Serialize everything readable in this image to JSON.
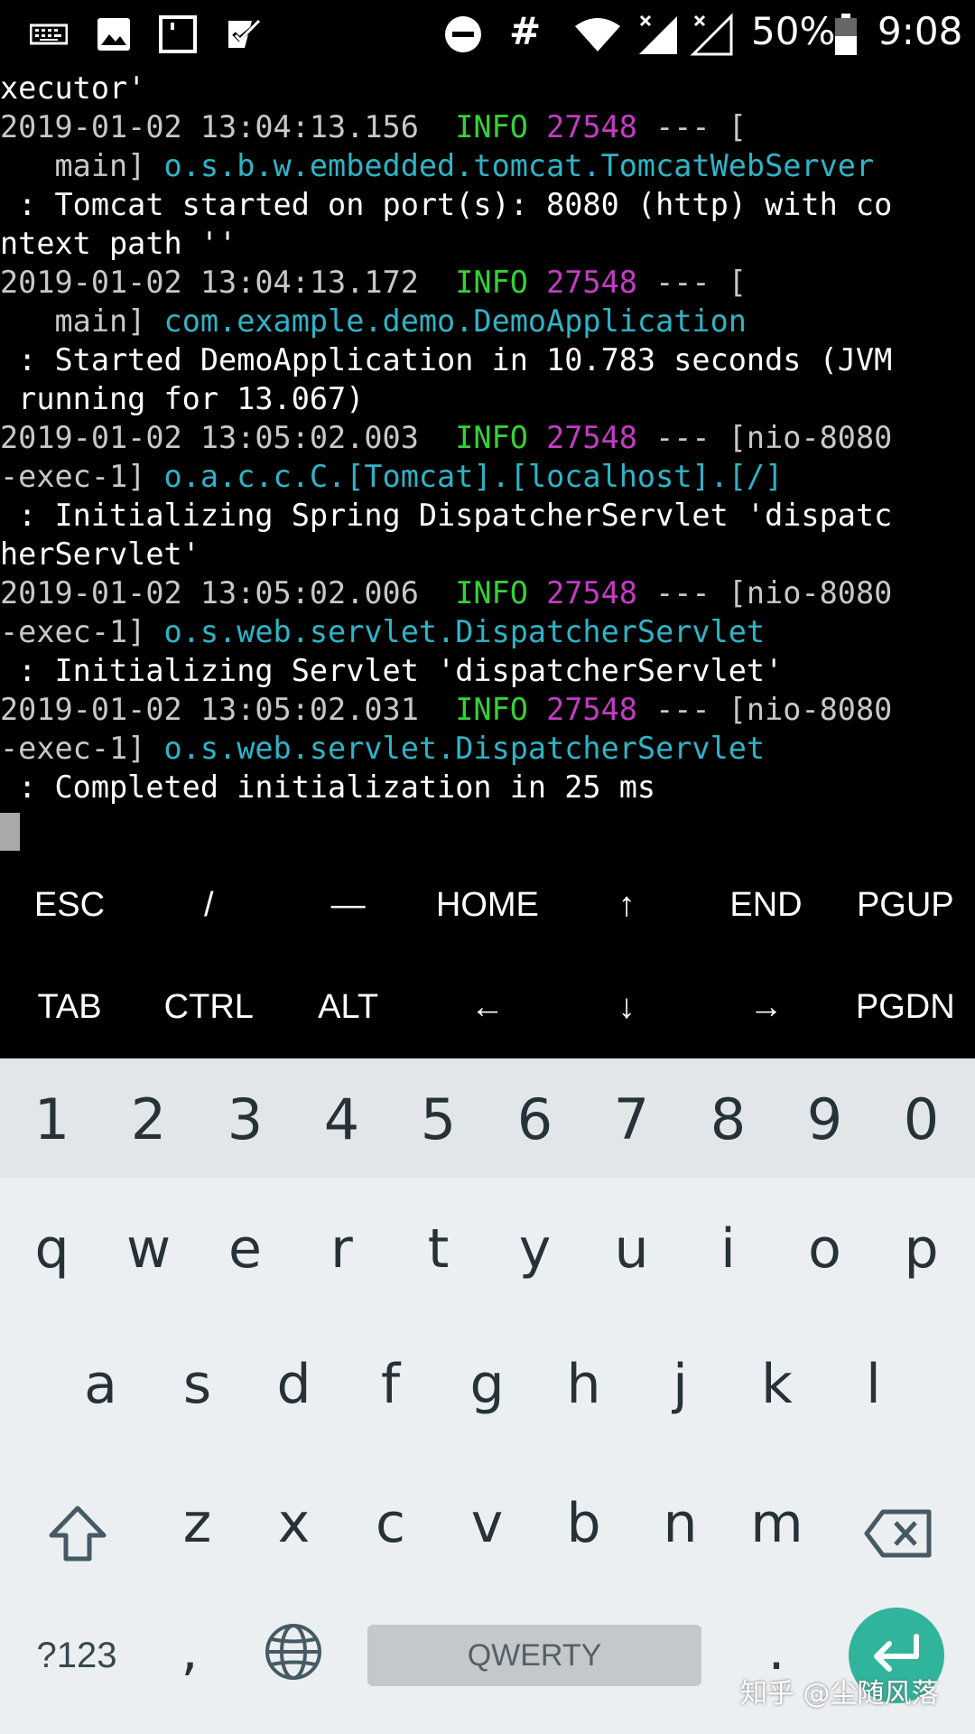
{
  "status_bar": {
    "icons": [
      "keyboard-icon",
      "image-icon",
      "sd-card-icon",
      "task-check-icon",
      "do-not-disturb-icon",
      "hash-icon",
      "wifi-icon",
      "signal-x-icon",
      "signal-x-icon",
      "battery-icon"
    ],
    "hash": "#",
    "battery_percent": "50%",
    "time": "9:08"
  },
  "terminal": {
    "lines": [
      [
        {
          "t": "xecutor'",
          "c": "white"
        }
      ],
      [
        {
          "t": "2019-01-02 13:04:13.156  ",
          "c": "gray"
        },
        {
          "t": "INFO",
          "c": "green"
        },
        {
          "t": " ",
          "c": "white"
        },
        {
          "t": "27548",
          "c": "magenta"
        },
        {
          "t": " --- [",
          "c": "gray"
        }
      ],
      [
        {
          "t": "   main] ",
          "c": "gray"
        },
        {
          "t": "o.s.b.w.embedded.tomcat.TomcatWebServer",
          "c": "cyan"
        }
      ],
      [
        {
          "t": " : Tomcat started on port(s): 8080 (http) with co",
          "c": "white"
        }
      ],
      [
        {
          "t": "ntext path ''",
          "c": "white"
        }
      ],
      [
        {
          "t": "2019-01-02 13:04:13.172  ",
          "c": "gray"
        },
        {
          "t": "INFO",
          "c": "green"
        },
        {
          "t": " ",
          "c": "white"
        },
        {
          "t": "27548",
          "c": "magenta"
        },
        {
          "t": " --- [",
          "c": "gray"
        }
      ],
      [
        {
          "t": "   main] ",
          "c": "gray"
        },
        {
          "t": "com.example.demo.DemoApplication",
          "c": "cyan"
        }
      ],
      [
        {
          "t": " : Started DemoApplication in 10.783 seconds (JVM",
          "c": "white"
        }
      ],
      [
        {
          "t": " running for 13.067)",
          "c": "white"
        }
      ],
      [
        {
          "t": "2019-01-02 13:05:02.003  ",
          "c": "gray"
        },
        {
          "t": "INFO",
          "c": "green"
        },
        {
          "t": " ",
          "c": "white"
        },
        {
          "t": "27548",
          "c": "magenta"
        },
        {
          "t": " --- [nio-8080",
          "c": "gray"
        }
      ],
      [
        {
          "t": "-exec-1] ",
          "c": "gray"
        },
        {
          "t": "o.a.c.c.C.[Tomcat].[localhost].[/]",
          "c": "cyan"
        }
      ],
      [
        {
          "t": " : Initializing Spring DispatcherServlet 'dispatc",
          "c": "white"
        }
      ],
      [
        {
          "t": "herServlet'",
          "c": "white"
        }
      ],
      [
        {
          "t": "2019-01-02 13:05:02.006  ",
          "c": "gray"
        },
        {
          "t": "INFO",
          "c": "green"
        },
        {
          "t": " ",
          "c": "white"
        },
        {
          "t": "27548",
          "c": "magenta"
        },
        {
          "t": " --- [nio-8080",
          "c": "gray"
        }
      ],
      [
        {
          "t": "-exec-1] ",
          "c": "gray"
        },
        {
          "t": "o.s.web.servlet.DispatcherServlet",
          "c": "cyan"
        }
      ],
      [
        {
          "t": " : Initializing Servlet 'dispatcherServlet'",
          "c": "white"
        }
      ],
      [
        {
          "t": "2019-01-02 13:05:02.031  ",
          "c": "gray"
        },
        {
          "t": "INFO",
          "c": "green"
        },
        {
          "t": " ",
          "c": "white"
        },
        {
          "t": "27548",
          "c": "magenta"
        },
        {
          "t": " --- [nio-8080",
          "c": "gray"
        }
      ],
      [
        {
          "t": "-exec-1] ",
          "c": "gray"
        },
        {
          "t": "o.s.web.servlet.DispatcherServlet",
          "c": "cyan"
        }
      ],
      [
        {
          "t": " : Completed initialization in 25 ms",
          "c": "white"
        }
      ]
    ]
  },
  "extra_keys": {
    "row1": [
      "ESC",
      "/",
      "—",
      "HOME",
      "↑",
      "END",
      "PGUP"
    ],
    "row2": [
      "TAB",
      "CTRL",
      "ALT",
      "←",
      "↓",
      "→",
      "PGDN"
    ]
  },
  "keyboard": {
    "numbers": [
      "1",
      "2",
      "3",
      "4",
      "5",
      "6",
      "7",
      "8",
      "9",
      "0"
    ],
    "row1": [
      "q",
      "w",
      "e",
      "r",
      "t",
      "y",
      "u",
      "i",
      "o",
      "p"
    ],
    "row2": [
      "a",
      "s",
      "d",
      "f",
      "g",
      "h",
      "j",
      "k",
      "l"
    ],
    "row3": [
      "z",
      "x",
      "c",
      "v",
      "b",
      "n",
      "m"
    ],
    "symbols_label": "?123",
    "comma": ",",
    "period": ".",
    "space_label": "QWERTY",
    "shift_icon": "shift-arrow-icon",
    "backspace_icon": "backspace-icon",
    "globe_icon": "globe-icon",
    "enter_icon": "enter-arrow-icon",
    "accent_color": "#30b49b"
  },
  "watermark": "知乎 @尘随风落",
  "colors": {
    "gray": "#c8c8c8",
    "green": "#35d135",
    "magenta": "#c23cc2",
    "cyan": "#2fb3c6",
    "white": "#ffffff"
  }
}
